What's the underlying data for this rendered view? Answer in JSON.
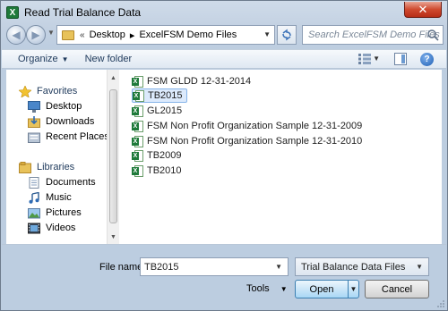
{
  "window": {
    "title": "Read Trial Balance Data",
    "app_icon": "X",
    "close_glyph": "✕"
  },
  "nav": {
    "back_glyph": "◀",
    "forward_glyph": "▶",
    "breadcrumb_sep": "«",
    "crumbs": [
      "Desktop",
      "ExcelFSM Demo Files"
    ],
    "crumb_arrow": "▸",
    "search_placeholder": "Search ExcelFSM Demo Files"
  },
  "toolbar": {
    "organize_label": "Organize",
    "new_folder_label": "New folder"
  },
  "sidebar": {
    "favorites": {
      "label": "Favorites",
      "items": [
        "Desktop",
        "Downloads",
        "Recent Places"
      ]
    },
    "libraries": {
      "label": "Libraries",
      "items": [
        "Documents",
        "Music",
        "Pictures",
        "Videos"
      ]
    }
  },
  "files": [
    "FSM GLDD 12-31-2014",
    "TB2015",
    "GL2015",
    "FSM Non Profit Organization Sample 12-31-2009",
    "FSM Non Profit Organization Sample 12-31-2010",
    "TB2009",
    "TB2010"
  ],
  "selected_file": "TB2015",
  "bottom": {
    "file_name_label": "File name:",
    "file_name_value": "TB2015",
    "filter_value": "Trial Balance Data Files",
    "tools_label": "Tools",
    "open_label": "Open",
    "cancel_label": "Cancel"
  }
}
